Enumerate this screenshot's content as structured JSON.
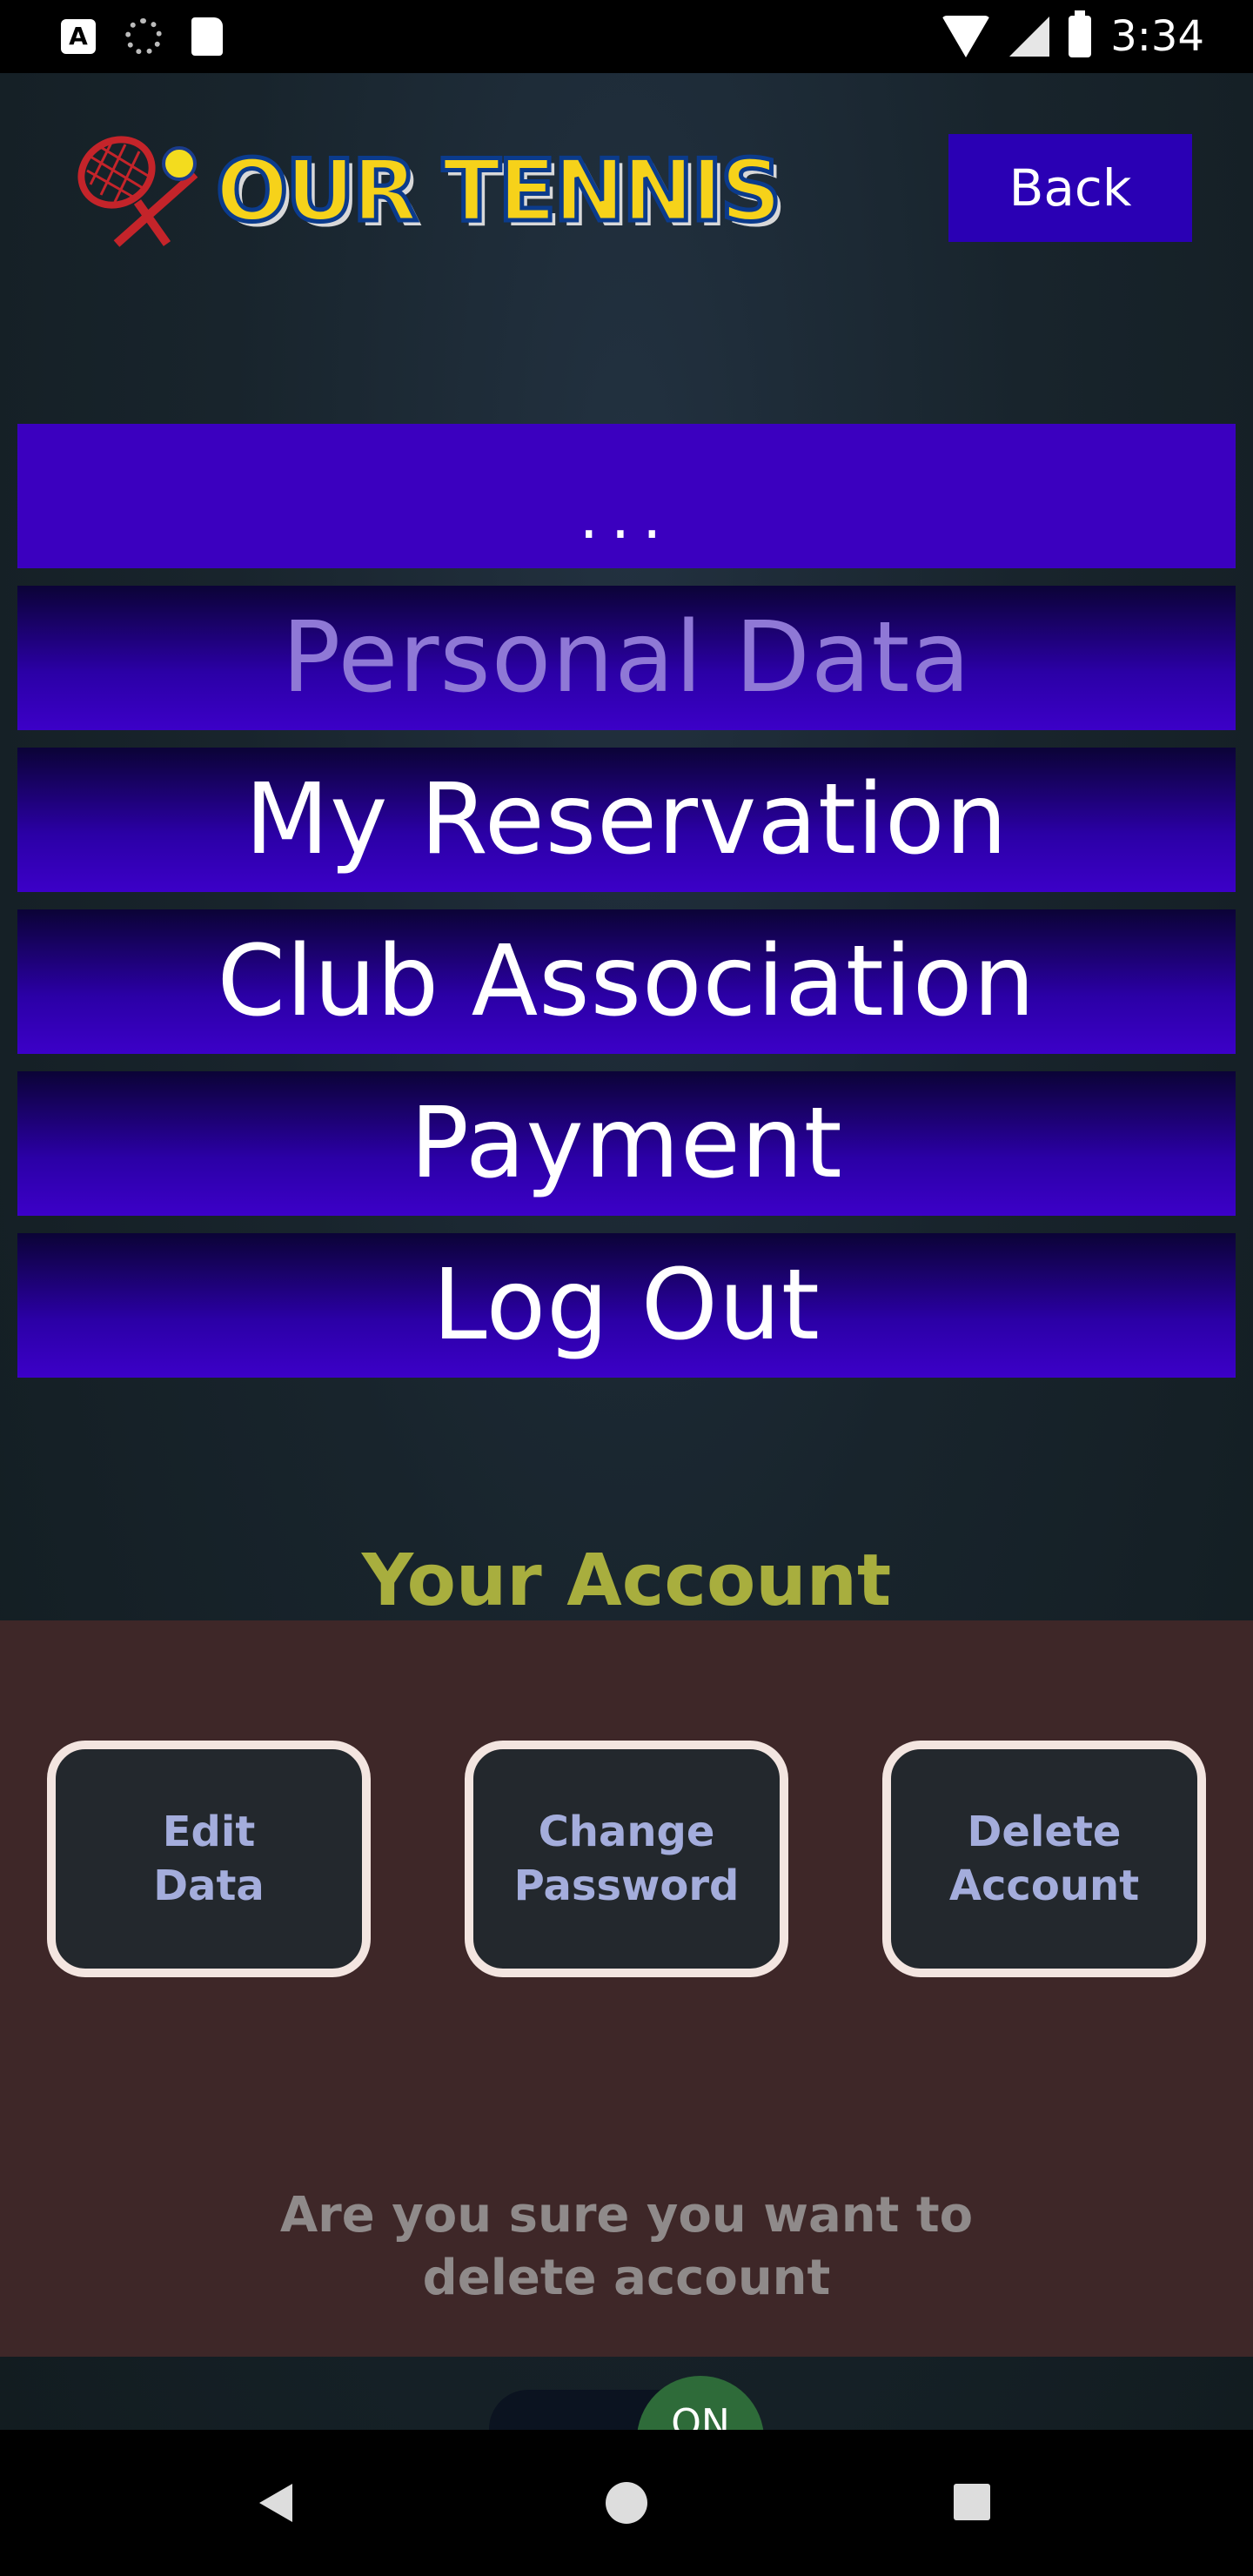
{
  "status_bar": {
    "time": "3:34",
    "left_icon_a": "A",
    "icons": [
      "a-notification-icon",
      "sync-icon",
      "sd-card-icon",
      "wifi-icon",
      "signal-icon",
      "battery-icon"
    ]
  },
  "header": {
    "logo_text": "OUR TENNIS",
    "back_label": "Back"
  },
  "menu": {
    "items": [
      {
        "label": "...",
        "state": "more"
      },
      {
        "label": "Personal Data",
        "state": "selected"
      },
      {
        "label": "My Reservation",
        "state": "normal"
      },
      {
        "label": "Club Association",
        "state": "normal"
      },
      {
        "label": "Payment",
        "state": "normal"
      },
      {
        "label": "Log Out",
        "state": "normal"
      }
    ]
  },
  "account": {
    "title": "Your Account",
    "buttons": [
      {
        "line1": "Edit",
        "line2": "Data"
      },
      {
        "line1": "Change",
        "line2": "Password"
      },
      {
        "line1": "Delete",
        "line2": "Account"
      }
    ],
    "confirm_line1": "Are you sure you want to",
    "confirm_line2": "delete account",
    "toggle_label": "ON"
  },
  "colors": {
    "accent": "#2a00b4",
    "title_yellow": "#a8ae3e",
    "panel_bg": "#3e2728",
    "toggle_on": "#2e6b39"
  }
}
